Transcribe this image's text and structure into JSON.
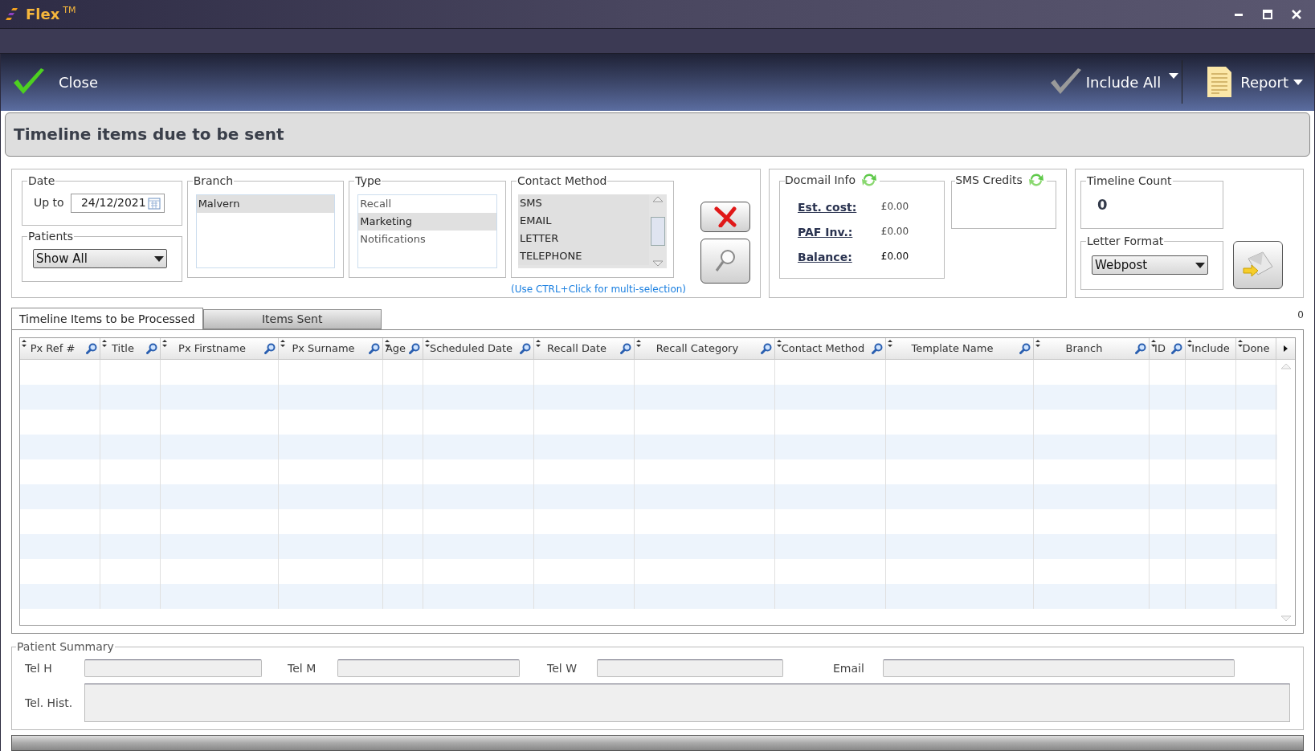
{
  "app": {
    "name": "Flex",
    "trademark": "TM"
  },
  "toolbar": {
    "close": "Close",
    "include_all": "Include All",
    "report": "Report"
  },
  "header": {
    "title": "Timeline items due to be sent"
  },
  "filters": {
    "date": {
      "legend": "Date",
      "label": "Up to",
      "value": "24/12/2021"
    },
    "patients": {
      "legend": "Patients",
      "value": "Show All"
    },
    "branch": {
      "legend": "Branch",
      "items": [
        {
          "label": "Malvern",
          "selected": true
        }
      ]
    },
    "type": {
      "legend": "Type",
      "items": [
        {
          "label": "Recall",
          "selected": false
        },
        {
          "label": "Marketing",
          "selected": true
        },
        {
          "label": "Notifications",
          "selected": false
        }
      ]
    },
    "contact_method": {
      "legend": "Contact Method",
      "items": [
        {
          "label": "SMS",
          "selected": true
        },
        {
          "label": "EMAIL",
          "selected": true
        },
        {
          "label": "LETTER",
          "selected": true
        },
        {
          "label": "TELEPHONE",
          "selected": true
        }
      ]
    },
    "hint": "(Use CTRL+Click for multi-selection)"
  },
  "docmail": {
    "legend": "Docmail Info",
    "rows": [
      {
        "label": "Est. cost:",
        "value": "£0.00"
      },
      {
        "label": "PAF Inv.:",
        "value": "£0.00"
      },
      {
        "label": "Balance:",
        "value": "£0.00"
      }
    ]
  },
  "sms_credits": {
    "legend": "SMS Credits"
  },
  "timeline_count": {
    "legend": "Timeline Count",
    "value": "0"
  },
  "letter_format": {
    "legend": "Letter Format",
    "value": "Webpost"
  },
  "tabs": [
    {
      "label": "Timeline Items to be Processed",
      "selected": true
    },
    {
      "label": "Items Sent",
      "selected": false
    }
  ],
  "row_count": "0",
  "table": {
    "columns": [
      "Px Ref #",
      "Title",
      "Px Firstname",
      "Px Surname",
      "Age",
      "Scheduled Date",
      "Recall Date",
      "Recall Category",
      "Contact Method",
      "Template Name",
      "Branch",
      "ID",
      "Include",
      "Done"
    ],
    "searchable": [
      true,
      true,
      true,
      true,
      true,
      true,
      true,
      true,
      true,
      true,
      true,
      true,
      false,
      false
    ]
  },
  "patient_summary": {
    "legend": "Patient Summary",
    "fields": [
      {
        "label": "Tel H"
      },
      {
        "label": "Tel M"
      },
      {
        "label": "Tel W"
      },
      {
        "label": "Email"
      }
    ],
    "history_label": "Tel. Hist."
  }
}
